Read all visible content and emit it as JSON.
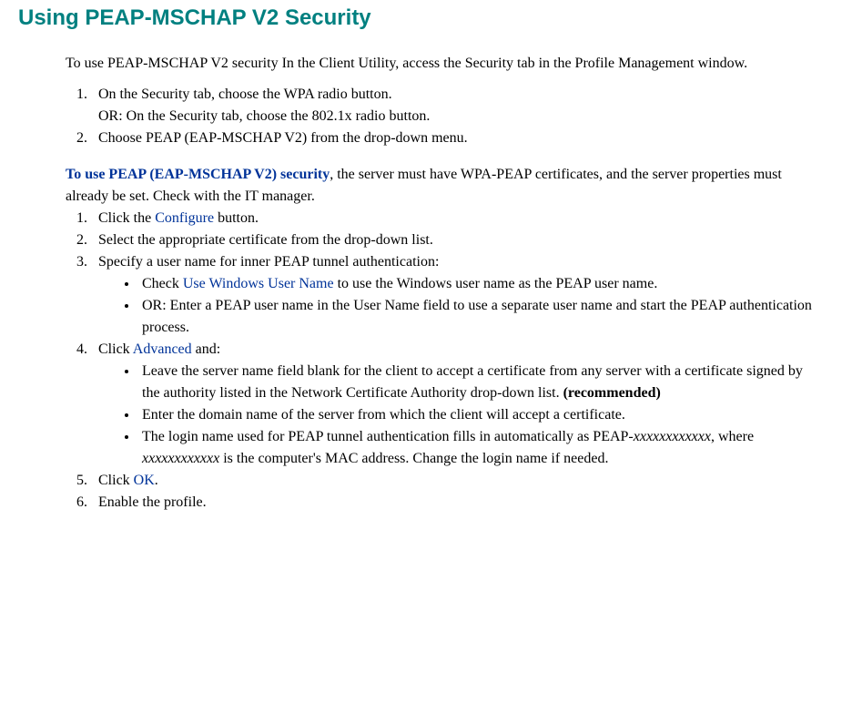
{
  "heading": "Using PEAP-MSCHAP V2 Security",
  "intro": "To use PEAP-MSCHAP V2 security In the  Client Utility, access the Security tab in the Profile Management window.",
  "list1": {
    "item1a": "On the Security tab, choose the WPA radio button.",
    "item1b": "OR: On the Security tab, choose the 802.1x radio button.",
    "item2": "Choose PEAP (EAP-MSCHAP V2) from the drop-down menu."
  },
  "subheading": {
    "bold": "To use PEAP (EAP-MSCHAP V2) security",
    "rest": ", the server must have WPA-PEAP certificates, and the server properties must already be set. Check with the IT manager."
  },
  "list2": {
    "item1_a": "Click the ",
    "item1_link": "Configure",
    "item1_b": " button.",
    "item2": "Select the appropriate certificate from the drop-down list.",
    "item3": "Specify a user name for inner PEAP tunnel authentication:",
    "item3_sub": {
      "b1_a": "Check ",
      "b1_link": "Use Windows User Name",
      "b1_b": " to use the Windows user name as the PEAP user name.",
      "b2": "OR: Enter a PEAP user name in the User Name field to use a separate user name and start the PEAP authentication process."
    },
    "item4_a": "Click ",
    "item4_link": "Advanced",
    "item4_b": " and:",
    "item4_sub": {
      "b1_a": "Leave the server name field blank for the client to accept a certificate from any server with a certificate signed by the authority listed in the Network Certificate Authority drop-down list. ",
      "b1_bold": "(recommended)",
      "b2": "Enter the domain name of the server from which the client will accept a certificate.",
      "b3_a": "The login name used for PEAP tunnel authentication fills in automatically as PEAP-",
      "b3_i1": "xxxxxxxxxxxx",
      "b3_b": ", where ",
      "b3_i2": "xxxxxxxxxxxx",
      "b3_c": " is the computer's MAC address. Change the login name if needed."
    },
    "item5_a": "Click ",
    "item5_link": "OK",
    "item5_b": ".",
    "item6": "Enable the profile."
  }
}
